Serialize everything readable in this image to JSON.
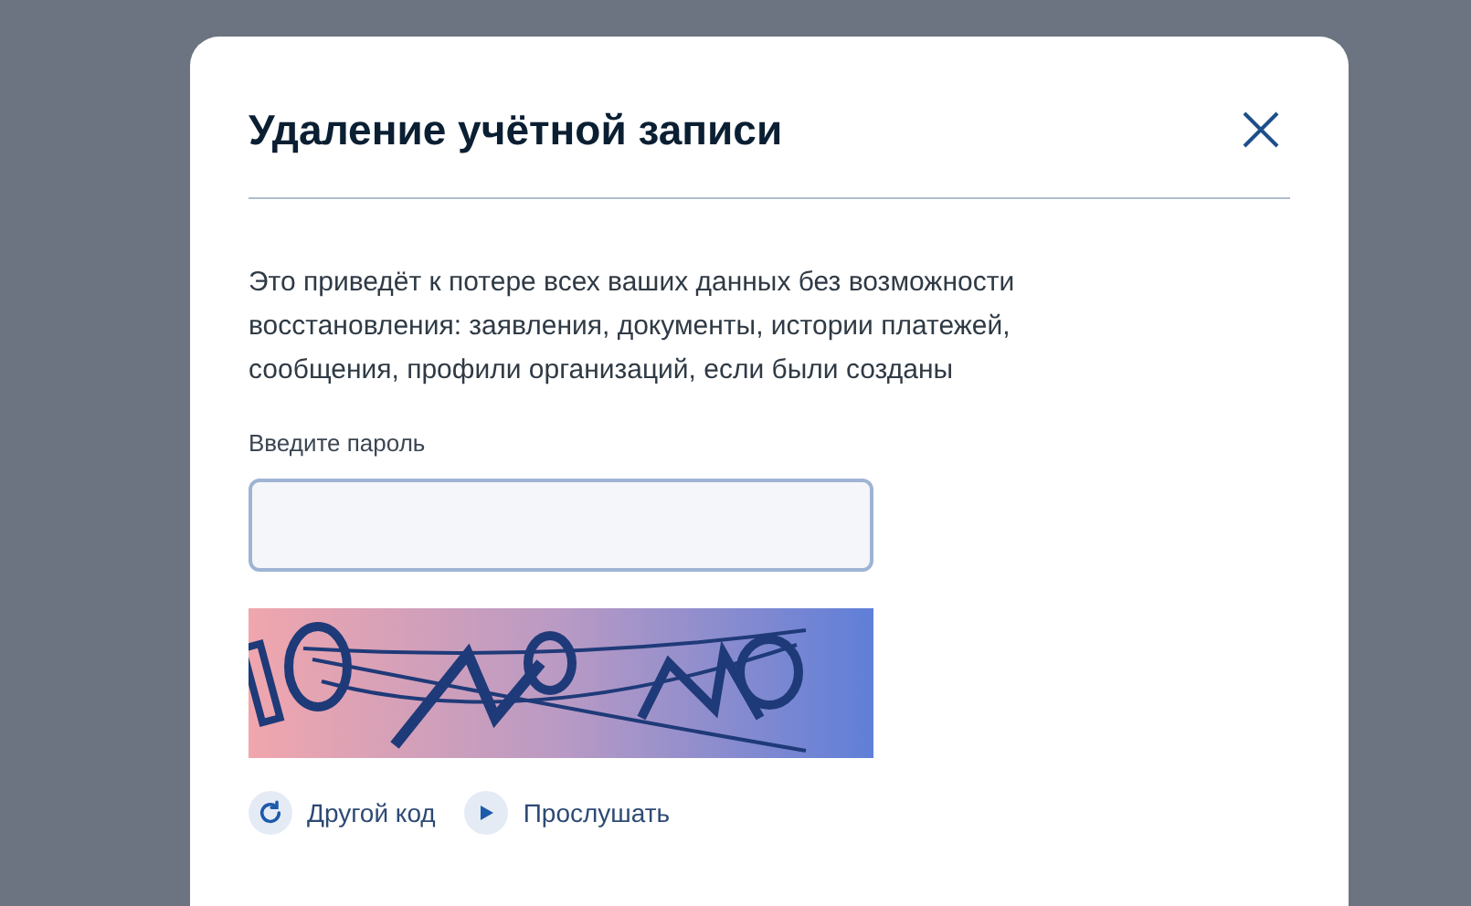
{
  "dialog": {
    "title": "Удаление учётной записи",
    "message": "Это приведёт к потере всех ваших данных без возможности восстановления: заявления, документы, истории платежей, сообщения, профили организаций, если были созданы",
    "password": {
      "label": "Введите пароль"
    },
    "actions": [
      {
        "kind": "refresh",
        "label": "Другой код"
      },
      {
        "kind": "play",
        "label": "Прослушать"
      }
    ]
  }
}
